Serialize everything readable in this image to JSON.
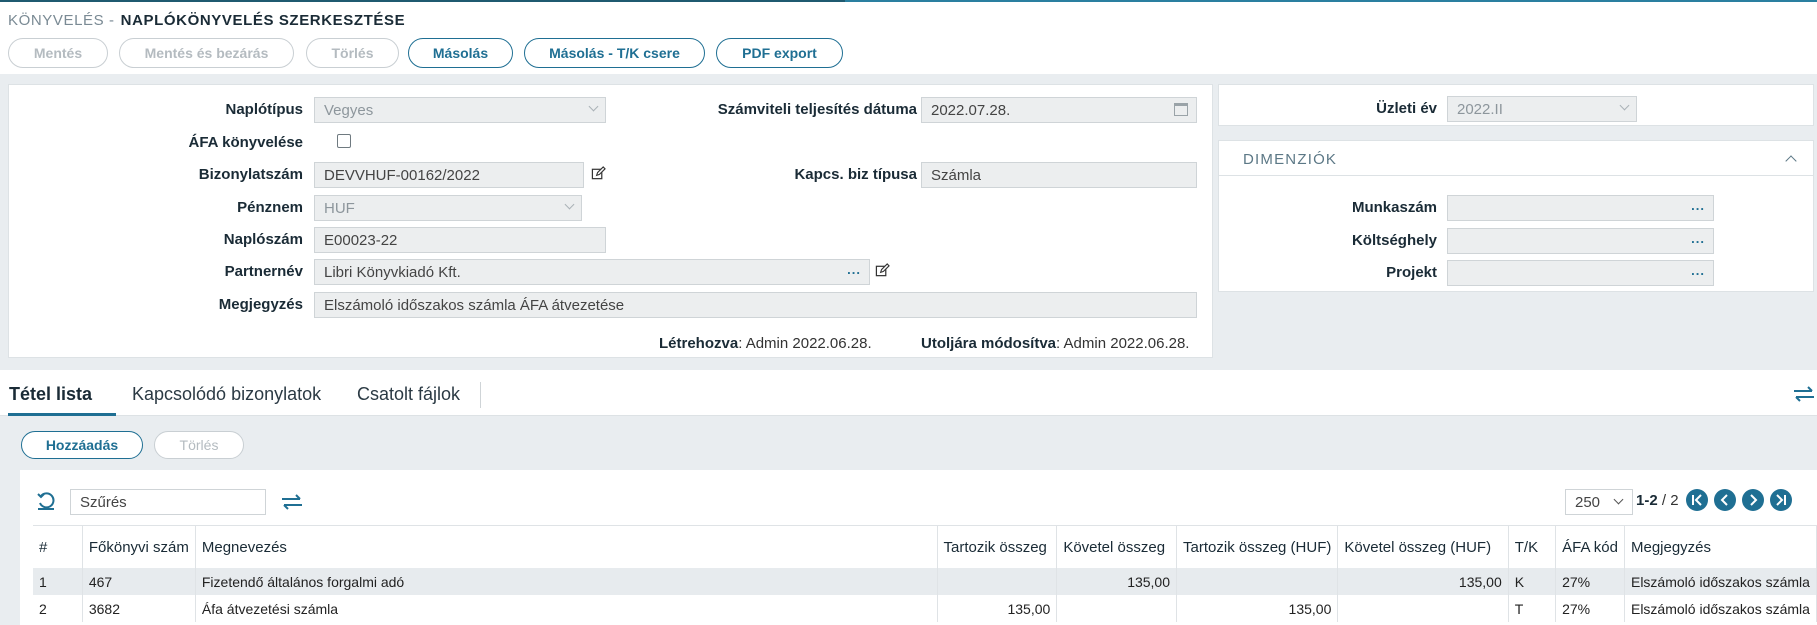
{
  "header": {
    "breadcrumb": "KÖNYVELÉS -",
    "title": "NAPLÓKÖNYVELÉS SZERKESZTÉSE"
  },
  "toolbar": {
    "save": "Mentés",
    "save_close": "Mentés és bezárás",
    "delete": "Törlés",
    "copy": "Másolás",
    "copy_swap": "Másolás - T/K csere",
    "pdf": "PDF export"
  },
  "form": {
    "journal_type_label": "Naplótípus",
    "journal_type_value": "Vegyes",
    "accounting_date_label": "Számviteli teljesítés dátuma",
    "accounting_date_value": "2022.07.28.",
    "vat_label": "ÁFA könyvelése",
    "doc_number_label": "Bizonylatszám",
    "doc_number_value": "DEVVHUF-00162/2022",
    "related_type_label": "Kapcs. biz típusa",
    "related_type_value": "Számla",
    "currency_label": "Pénznem",
    "currency_value": "HUF",
    "journal_number_label": "Naplószám",
    "journal_number_value": "E00023-22",
    "partner_label": "Partnernév",
    "partner_value": "Libri Könyvkiadó Kft.",
    "note_label": "Megjegyzés",
    "note_value": "Elszámoló időszakos számla ÁFA átvezetése",
    "created_label": "Létrehozva",
    "created_value": ": Admin 2022.06.28.",
    "modified_label": "Utoljára módosítva",
    "modified_value": ": Admin 2022.06.28."
  },
  "side": {
    "fiscal_year_label": "Üzleti év",
    "fiscal_year_value": "2022.II",
    "dimensions_title": "DIMENZIÓK",
    "job_label": "Munkaszám",
    "cost_center_label": "Költséghely",
    "project_label": "Projekt"
  },
  "tabs": [
    "Tétel lista",
    "Kapcsolódó bizonylatok",
    "Csatolt fájlok"
  ],
  "grid": {
    "add": "Hozzáadás",
    "delete": "Törlés",
    "filter_placeholder": "Szűrés",
    "page_size": "250",
    "page_range": "1-2",
    "page_total": " / 2",
    "columns": [
      "#",
      "Főkönyvi szám",
      "Megnevezés",
      "Tartozik összeg",
      "Követel összeg",
      "Tartozik összeg (HUF)",
      "Követel összeg (HUF)",
      "T/K",
      "ÁFA kód",
      "Megjegyzés"
    ],
    "rows": [
      [
        "1",
        "467",
        "Fizetendő általános forgalmi adó",
        "",
        "135,00",
        "",
        "135,00",
        "K",
        "27%",
        "Elszámoló időszakos számla"
      ],
      [
        "2",
        "3682",
        "Áfa átvezetési számla",
        "135,00",
        "",
        "135,00",
        "",
        "T",
        "27%",
        "Elszámoló időszakos számla"
      ]
    ]
  }
}
